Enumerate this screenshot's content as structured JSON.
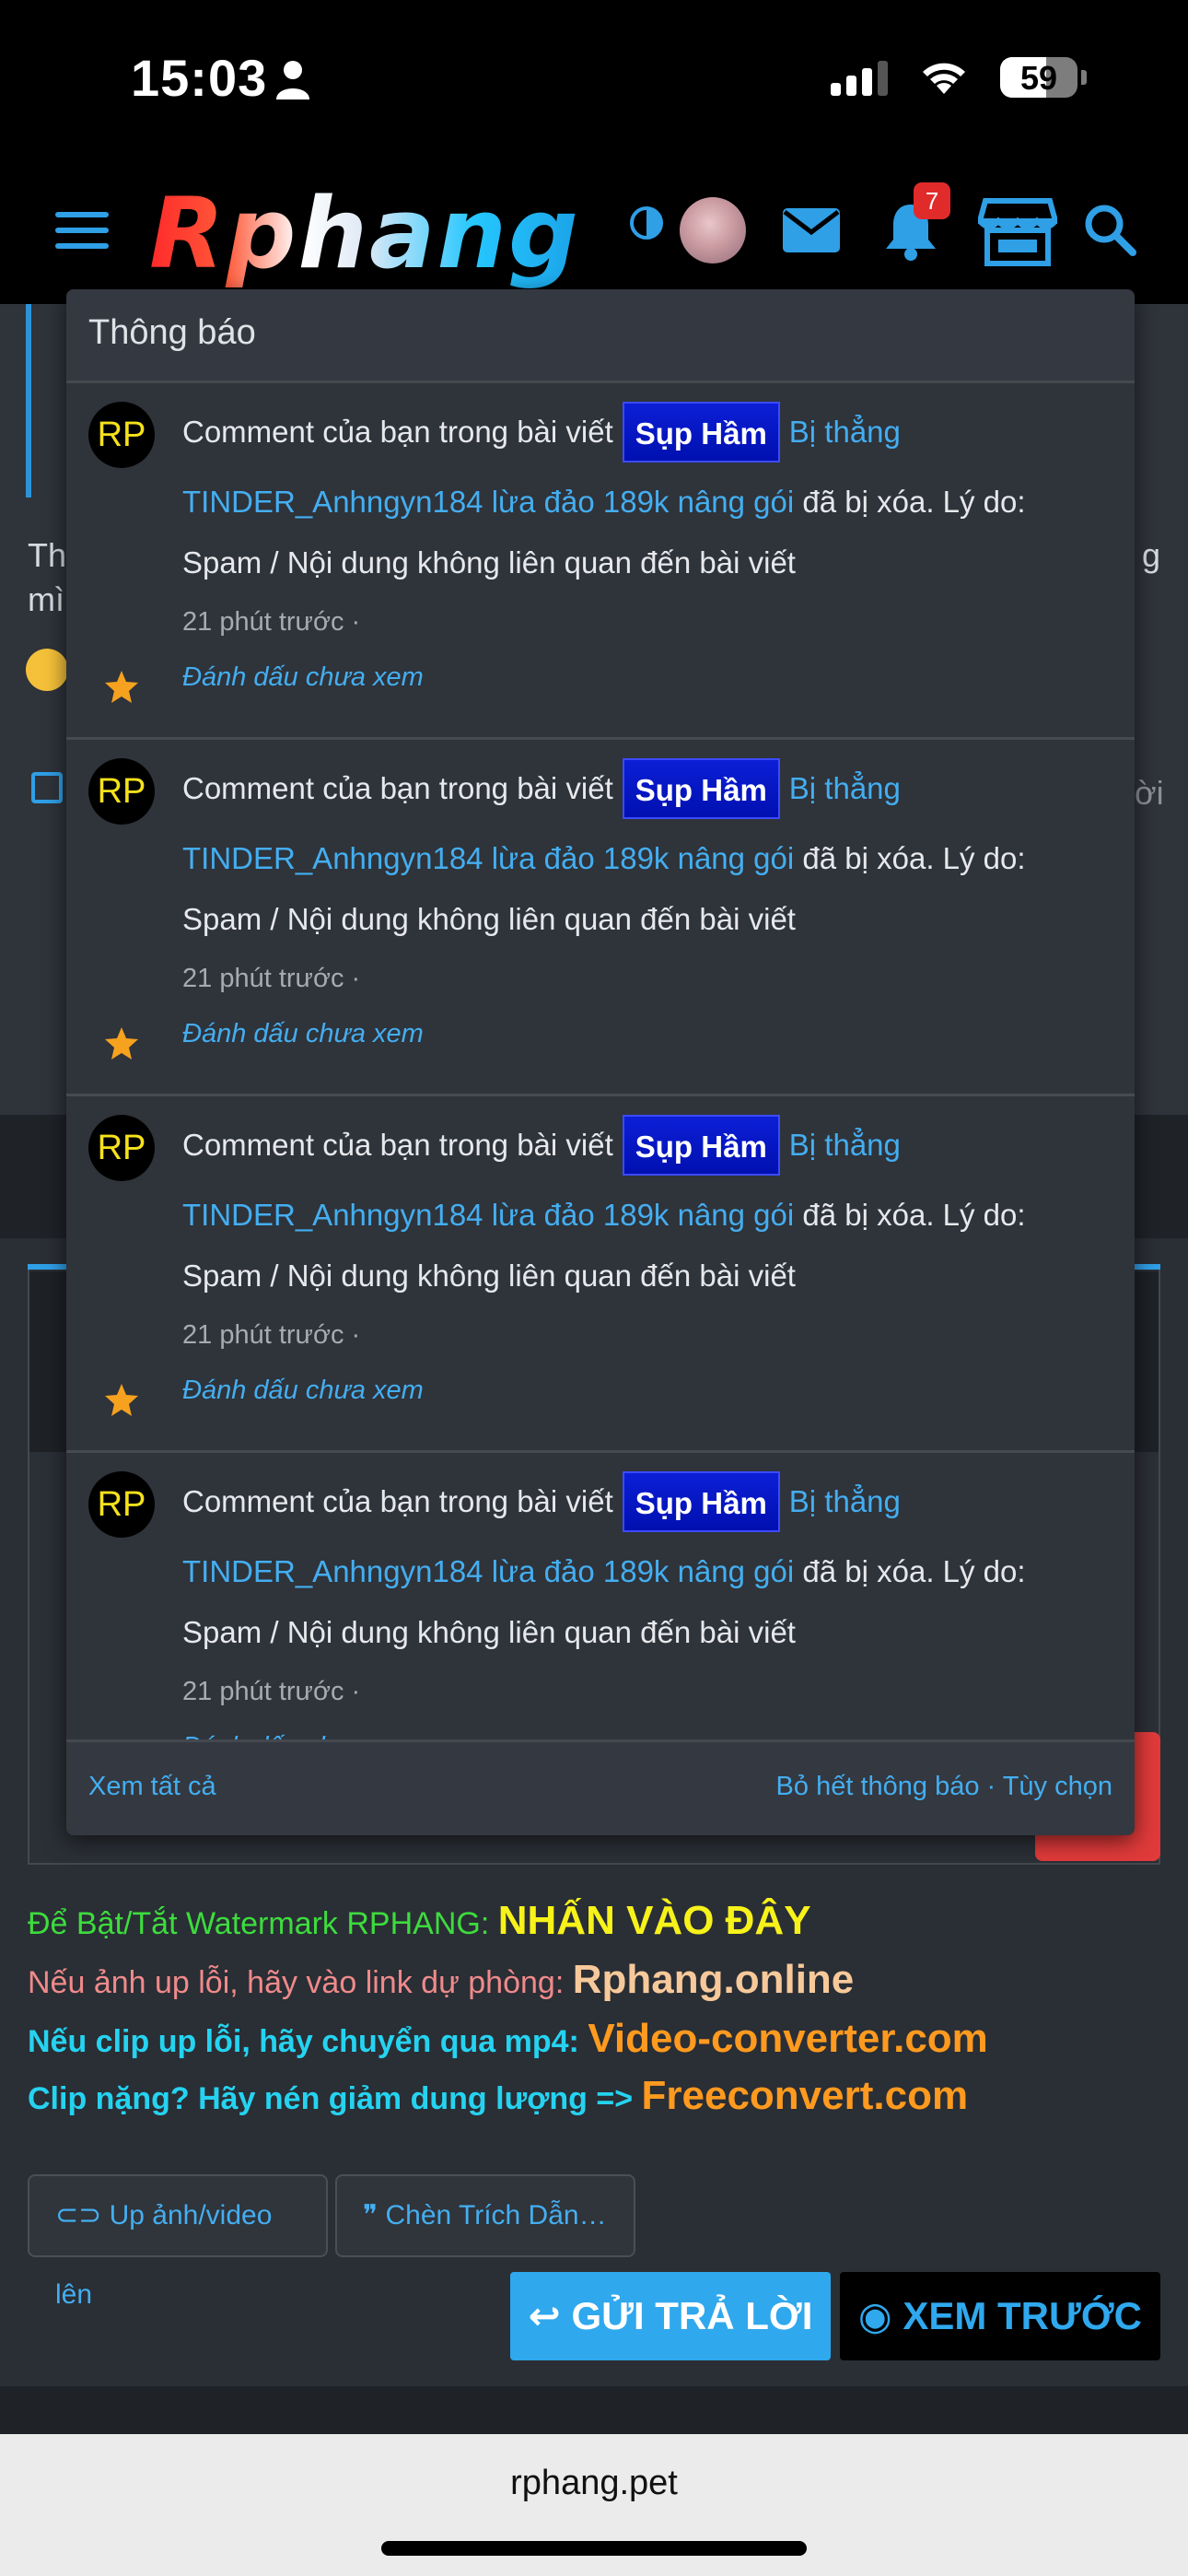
{
  "status_bar": {
    "time": "15:03",
    "battery": "59"
  },
  "header": {
    "logo_text": "Rphang",
    "notification_count": "7"
  },
  "background": {
    "post_snippet_1": "Th",
    "post_snippet_2": "mì",
    "post_snippet_right_1": "g",
    "post_snippet_right_2": "ời"
  },
  "popup": {
    "title": "Thông báo",
    "notifications": [
      {
        "avatar": "RP",
        "prefix": "Comment của bạn trong bài viết",
        "thread_tag": "Sụp Hầm",
        "thread_title": "Bị thẳng",
        "user": "TINDER_Anhngyn184 lừa đảo 189k nâng gói",
        "reason": "đã bị xóa. Lý do: Spam / Nội dung không liên quan đến bài viết",
        "time": "21 phút trước ·",
        "mark_unread": "Đánh dấu chưa xem"
      },
      {
        "avatar": "RP",
        "prefix": "Comment của bạn trong bài viết",
        "thread_tag": "Sụp Hầm",
        "thread_title": "Bị thẳng",
        "user": "TINDER_Anhngyn184 lừa đảo 189k nâng gói",
        "reason": "đã bị xóa. Lý do: Spam / Nội dung không liên quan đến bài viết",
        "time": "21 phút trước ·",
        "mark_unread": "Đánh dấu chưa xem"
      },
      {
        "avatar": "RP",
        "prefix": "Comment của bạn trong bài viết",
        "thread_tag": "Sụp Hầm",
        "thread_title": "Bị thẳng",
        "user": "TINDER_Anhngyn184 lừa đảo 189k nâng gói",
        "reason": "đã bị xóa. Lý do: Spam / Nội dung không liên quan đến bài viết",
        "time": "21 phút trước ·",
        "mark_unread": "Đánh dấu chưa xem"
      },
      {
        "avatar": "RP",
        "prefix": "Comment của bạn trong bài viết",
        "thread_tag": "Sụp Hầm",
        "thread_title": "Bị thẳng",
        "user": "TINDER_Anhngyn184 lừa đảo 189k nâng gói",
        "reason": "đã bị xóa. Lý do: Spam / Nội dung không liên quan đến bài viết",
        "time": "21 phút trước ·",
        "mark_unread": "Đánh dấu chưa xem"
      }
    ],
    "footer_left": "Xem tất cả",
    "footer_right": "Bỏ hết thông báo · Tùy chọn"
  },
  "promo": {
    "watermark_label": "Để Bật/Tắt Watermark RPHANG:",
    "watermark_link": "NHẤN VÀO ĐÂY",
    "backup_label": "Nếu ảnh up lỗi, hãy vào link dự phòng:",
    "backup_link": "Rphang.online",
    "clip_label": "Nếu clip up lỗi, hãy chuyển qua mp4:",
    "clip_link": "Video-converter.com",
    "compress_label": "Clip nặng? Hãy nén giảm dung lượng =>",
    "compress_link": "Freeconvert.com"
  },
  "editor": {
    "upload_label": "Up ảnh/video lên",
    "quote_label": "Chèn Trích Dẫn…",
    "send_label": "GỬI TRẢ LỜI",
    "preview_label": "XEM TRƯỚC"
  },
  "browser": {
    "url": "rphang.pet"
  },
  "colors": {
    "accent": "#2fa8ee",
    "link": "#44aef0",
    "thread_tag": "#0010b0",
    "badge": "#e12b2b",
    "watermark": "#3ddc3d",
    "watermark_link": "#f7f21a",
    "backup_label": "#f08a8a",
    "backup_link": "#f7c99a",
    "cyan": "#25d3f0",
    "orange": "#ff9a1f"
  }
}
